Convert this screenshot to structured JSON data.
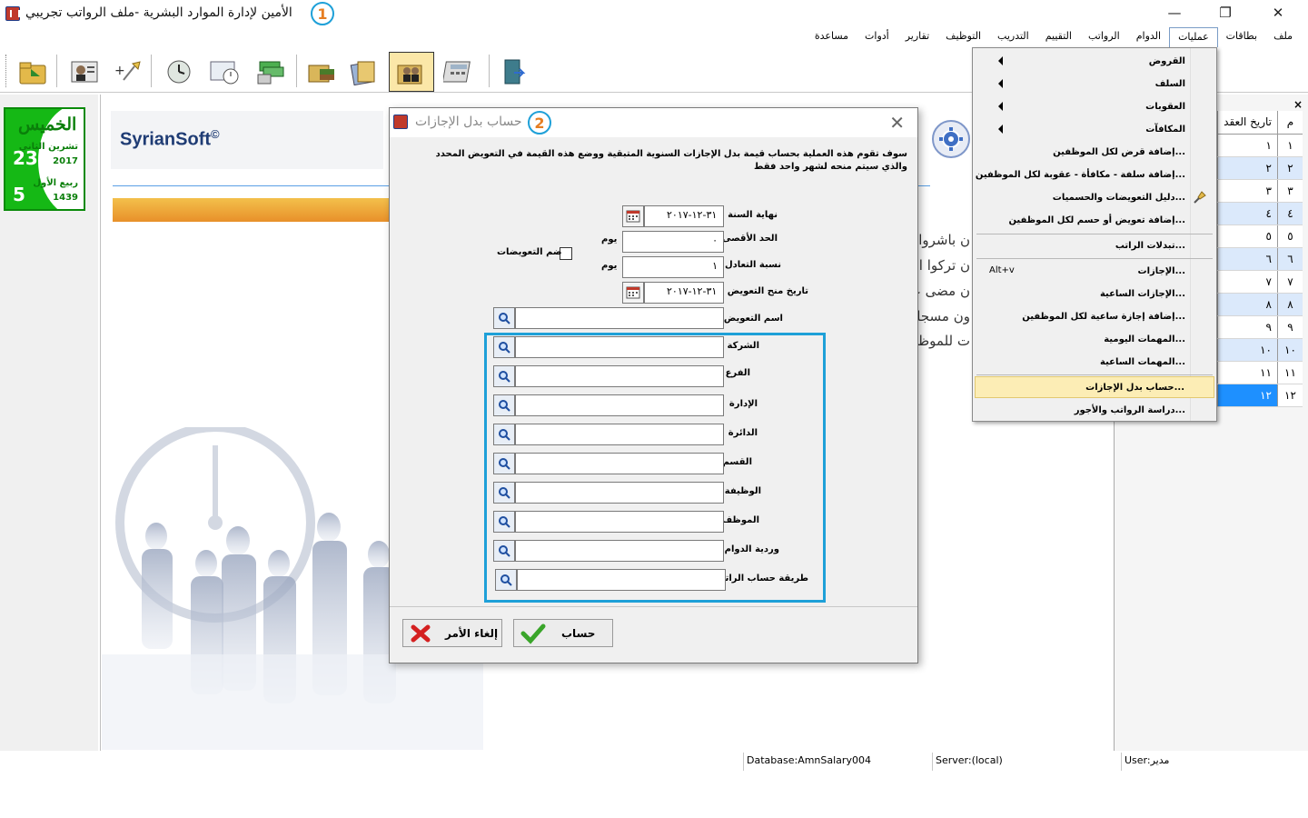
{
  "window": {
    "title": "الأمين لإدارة الموارد البشرية -ملف الرواتب تجريبي",
    "step1": "1",
    "minimize_glyph": "—",
    "restore_glyph": "❐",
    "close_glyph": "✕"
  },
  "menubar": {
    "items": [
      "ملف",
      "بطاقات",
      "عمليات",
      "الدوام",
      "الرواتب",
      "التقييم",
      "التدريب",
      "التوظيف",
      "تقارير",
      "أدوات",
      "مساعدة"
    ]
  },
  "toolbar": {
    "buttons": [
      "import-icon",
      "employee-card-icon",
      "add-employee-icon",
      "clock-icon",
      "attendance-icon",
      "money-icon",
      "books-icon",
      "documents-icon",
      "employees-icon",
      "calculator-icon",
      "exit-icon"
    ]
  },
  "calendar": {
    "day_name": "الخميس",
    "gregorian_day": "23",
    "gregorian_month": "تشرين الثاني",
    "gregorian_year": "2017",
    "hijri_day": "5",
    "hijri_month": "ربيع الأول",
    "hijri_year": "1439"
  },
  "logo": {
    "text": "SyrianSoft",
    "mark": "©"
  },
  "background_text": [
    "ن باشروا ال",
    "ن تركوا الع",
    "ن مضى علي",
    "ون مسجلو",
    "ت للموظف"
  ],
  "grid": {
    "close_glyph": "×",
    "headers": {
      "date": "تاريخ العقد",
      "num": "م"
    },
    "rows": [
      {
        "num": "١",
        "date": "١"
      },
      {
        "num": "٢",
        "date": "٢"
      },
      {
        "num": "٣",
        "date": "٣"
      },
      {
        "num": "٤",
        "date": "٤"
      },
      {
        "num": "٥",
        "date": "٥"
      },
      {
        "num": "٦",
        "date": "٦"
      },
      {
        "num": "٧",
        "date": "٧"
      },
      {
        "num": "٨",
        "date": "٨"
      },
      {
        "num": "٩",
        "date": "٩"
      },
      {
        "num": "١٠",
        "date": "١٠"
      },
      {
        "num": "١١",
        "date": "١١"
      },
      {
        "num": "١٢",
        "date": "١٢"
      }
    ]
  },
  "dropdown": {
    "items": [
      {
        "label": "القروض",
        "submenu": true
      },
      {
        "label": "السلف",
        "submenu": true
      },
      {
        "label": "العقوبات",
        "submenu": true
      },
      {
        "label": "المكافآت",
        "submenu": true
      },
      {
        "label": "إضافة قرض لكل الموظفين..."
      },
      {
        "label": "إضافة سلفة - مكافأة - عقوبة لكل الموظفين..."
      },
      {
        "label": "دليل التعويضات والحسميات..."
      },
      {
        "label": "إضافة تعويض أو حسم لكل الموظفين..."
      },
      {
        "label": "تبدلات الراتب..."
      },
      {
        "label": "الإجازات...",
        "shortcut": "Alt+v"
      },
      {
        "label": "الإجازات الساعية..."
      },
      {
        "label": "إضافة إجازة ساعية لكل الموظفين..."
      },
      {
        "label": "المهمات اليومية..."
      },
      {
        "label": "المهمات الساعية..."
      },
      {
        "label": "حساب بدل الإجازات..."
      },
      {
        "label": "دراسة الرواتب والأجور..."
      }
    ]
  },
  "dialog": {
    "title": "حساب بدل الإجازات",
    "step2": "2",
    "close_glyph": "✕",
    "description": "سوف تقوم هذه العملية بحساب قيمة بدل الإجازات السنوية المتبقية ووضع هذه القيمة في التعويض المحدد والذي سيتم منحه لشهر واحد فقط",
    "fields": {
      "year_end": {
        "label": "نهاية السنة",
        "value": "٣١-١٢-٢٠١٧"
      },
      "max_limit": {
        "label": "الحد الأقصى",
        "value": "٠",
        "unit": "يوم"
      },
      "equivalence_ratio": {
        "label": "نسبة التعادل",
        "value": "١",
        "unit": "يوم"
      },
      "grant_date": {
        "label": "تاريخ منح التعويض",
        "value": "٣١-١٢-٢٠١٧"
      },
      "compensation_name": {
        "label": "اسم التعويض",
        "value": ""
      },
      "merge_compensations": {
        "label": "ضم التعويضات"
      }
    },
    "filters": [
      {
        "label": "الشركة",
        "value": ""
      },
      {
        "label": "الفرع",
        "value": ""
      },
      {
        "label": "الإدارة",
        "value": ""
      },
      {
        "label": "الدائرة",
        "value": ""
      },
      {
        "label": "القسم",
        "value": ""
      },
      {
        "label": "الوظيفة",
        "value": ""
      },
      {
        "label": "الموظف",
        "value": ""
      },
      {
        "label": "وردية الدوام",
        "value": ""
      },
      {
        "label": "طريقة حساب الراتب",
        "value": ""
      }
    ],
    "buttons": {
      "calculate": "حساب",
      "cancel": "إلغاء الأمر"
    }
  },
  "statusbar": {
    "database": "Database:AmnSalary004",
    "server": "Server:(local)",
    "user": "User:مدير"
  },
  "colors": {
    "accent_blue": "#1ea0d8",
    "highlight_yellow": "#fcedb5",
    "calendar_green": "#15b815",
    "selected_row": "#1e90ff"
  }
}
